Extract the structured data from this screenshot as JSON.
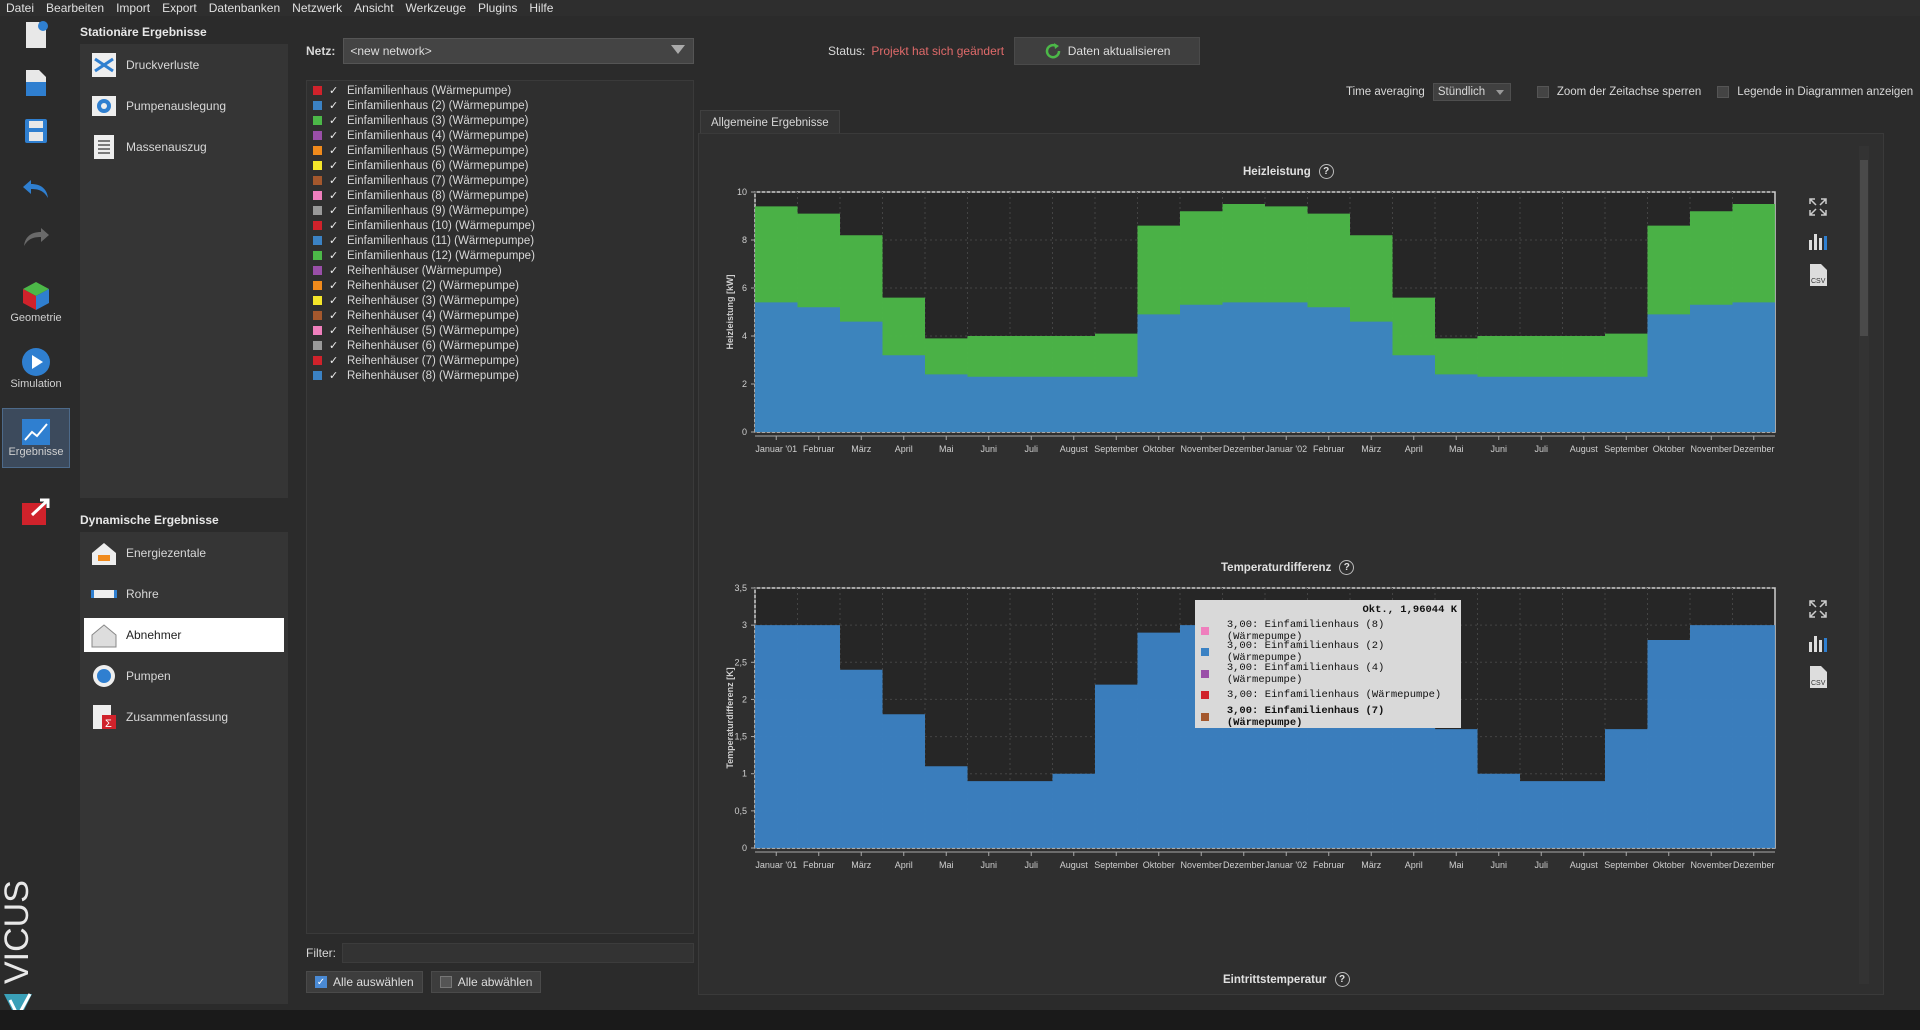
{
  "menu": [
    "Datei",
    "Bearbeiten",
    "Import",
    "Export",
    "Datenbanken",
    "Netzwerk",
    "Ansicht",
    "Werkzeuge",
    "Plugins",
    "Hilfe"
  ],
  "sidebar": {
    "geometry_label": "Geometrie",
    "simulation_label": "Simulation",
    "results_label": "Ergebnisse",
    "brand": "VICUS"
  },
  "stationary": {
    "title": "Stationäre Ergebnisse",
    "items": [
      "Druckverluste",
      "Pumpenauslegung",
      "Massenauszug"
    ]
  },
  "dynamic": {
    "title": "Dynamische Ergebnisse",
    "items": [
      "Energiezentale",
      "Rohre",
      "Abnehmer",
      "Pumpen",
      "Zusammenfassung"
    ]
  },
  "network": {
    "label": "Netz:",
    "value": "<new network>"
  },
  "status": {
    "label": "Status:",
    "value": "Projekt hat sich geändert",
    "update_button": "Daten aktualisieren"
  },
  "options": {
    "time_averaging_label": "Time averaging",
    "time_averaging_value": "Stündlich",
    "zoom_lock_label": "Zoom der Zeitachse sperren",
    "legend_label": "Legende in Diagrammen anzeigen"
  },
  "consumers": [
    {
      "name": "Einfamilienhaus (Wärmepumpe)",
      "color": "#d0222b"
    },
    {
      "name": "Einfamilienhaus (2) (Wärmepumpe)",
      "color": "#3b82c4"
    },
    {
      "name": "Einfamilienhaus (3) (Wärmepumpe)",
      "color": "#4cb848"
    },
    {
      "name": "Einfamilienhaus (4) (Wärmepumpe)",
      "color": "#9a4fa8"
    },
    {
      "name": "Einfamilienhaus (5) (Wärmepumpe)",
      "color": "#f08a1c"
    },
    {
      "name": "Einfamilienhaus (6) (Wärmepumpe)",
      "color": "#f5e62a"
    },
    {
      "name": "Einfamilienhaus (7) (Wärmepumpe)",
      "color": "#a4582d"
    },
    {
      "name": "Einfamilienhaus (8) (Wärmepumpe)",
      "color": "#ef7fbd"
    },
    {
      "name": "Einfamilienhaus (9) (Wärmepumpe)",
      "color": "#999999"
    },
    {
      "name": "Einfamilienhaus (10) (Wärmepumpe)",
      "color": "#d0222b"
    },
    {
      "name": "Einfamilienhaus (11) (Wärmepumpe)",
      "color": "#3b82c4"
    },
    {
      "name": "Einfamilienhaus (12) (Wärmepumpe)",
      "color": "#4cb848"
    },
    {
      "name": "Reihenhäuser (Wärmepumpe)",
      "color": "#9a4fa8"
    },
    {
      "name": "Reihenhäuser (2) (Wärmepumpe)",
      "color": "#f08a1c"
    },
    {
      "name": "Reihenhäuser (3) (Wärmepumpe)",
      "color": "#f5e62a"
    },
    {
      "name": "Reihenhäuser (4) (Wärmepumpe)",
      "color": "#a4582d"
    },
    {
      "name": "Reihenhäuser (5) (Wärmepumpe)",
      "color": "#ef7fbd"
    },
    {
      "name": "Reihenhäuser (6) (Wärmepumpe)",
      "color": "#999999"
    },
    {
      "name": "Reihenhäuser (7) (Wärmepumpe)",
      "color": "#d0222b"
    },
    {
      "name": "Reihenhäuser (8) (Wärmepumpe)",
      "color": "#3b82c4"
    }
  ],
  "filter_label": "Filter:",
  "select_all": "Alle auswählen",
  "deselect_all": "Alle abwählen",
  "results_tab": "Allgemeine Ergebnisse",
  "chart_data": [
    {
      "type": "area",
      "title": "Heizleistung",
      "ylabel": "Heizleistung [kW]",
      "xlabel": "",
      "ylim": [
        0,
        10
      ],
      "yticks": [
        0,
        2,
        4,
        6,
        8,
        10
      ],
      "categories": [
        "Januar '01",
        "Februar",
        "März",
        "April",
        "Mai",
        "Juni",
        "Juli",
        "August",
        "September",
        "Oktober",
        "November",
        "Dezember",
        "Januar '02",
        "Februar",
        "März",
        "April",
        "Mai",
        "Juni",
        "Juli",
        "August",
        "September",
        "Oktober",
        "November",
        "Dezember"
      ],
      "series": [
        {
          "color": "#3b82c4",
          "values": [
            5.4,
            5.2,
            4.6,
            3.2,
            2.4,
            2.3,
            2.3,
            2.3,
            2.3,
            4.9,
            5.3,
            5.4,
            5.4,
            5.2,
            4.6,
            3.2,
            2.4,
            2.3,
            2.3,
            2.3,
            2.3,
            4.9,
            5.3,
            5.4
          ]
        },
        {
          "color": "#4cb848",
          "values": [
            9.4,
            9.1,
            8.2,
            5.6,
            3.9,
            4.0,
            4.0,
            4.0,
            4.1,
            8.6,
            9.2,
            9.5,
            9.4,
            9.1,
            8.2,
            5.6,
            3.9,
            4.0,
            4.0,
            4.0,
            4.1,
            8.6,
            9.2,
            9.5
          ]
        }
      ],
      "grid": true
    },
    {
      "type": "area",
      "title": "Temperaturdifferenz",
      "ylabel": "Temperaturdifferenz [K]",
      "xlabel": "",
      "ylim": [
        0,
        3.5
      ],
      "yticks": [
        0,
        0.5,
        1,
        1.5,
        2,
        2.5,
        3,
        3.5
      ],
      "categories": [
        "Januar '01",
        "Februar",
        "März",
        "April",
        "Mai",
        "Juni",
        "Juli",
        "August",
        "September",
        "Oktober",
        "November",
        "Dezember",
        "Januar '02",
        "Februar",
        "März",
        "April",
        "Mai",
        "Juni",
        "Juli",
        "August",
        "September",
        "Oktober",
        "November",
        "Dezember"
      ],
      "series": [
        {
          "color": "#3b82c4",
          "values": [
            3.0,
            3.0,
            2.4,
            1.8,
            1.1,
            0.9,
            0.9,
            1.0,
            2.2,
            2.9,
            3.0,
            3.0,
            3.0,
            3.0,
            3.0,
            2.5,
            1.6,
            1.0,
            0.9,
            0.9,
            1.6,
            2.8,
            3.0,
            3.0
          ]
        }
      ],
      "grid": true
    }
  ],
  "tooltip": {
    "header": "Okt., 1,96044 K",
    "rows": [
      {
        "text": "3,00: Einfamilienhaus (8) (Wärmepumpe)",
        "color": "#ef7fbd"
      },
      {
        "text": "3,00: Einfamilienhaus (2) (Wärmepumpe)",
        "color": "#3b82c4"
      },
      {
        "text": "3,00: Einfamilienhaus (4) (Wärmepumpe)",
        "color": "#9a4fa8"
      },
      {
        "text": "3,00: Einfamilienhaus (Wärmepumpe)",
        "color": "#d0222b"
      },
      {
        "text": "3,00: Einfamilienhaus (7) (Wärmepumpe)",
        "color": "#a4582d"
      }
    ]
  },
  "third_chart_title": "Eintrittstemperatur"
}
